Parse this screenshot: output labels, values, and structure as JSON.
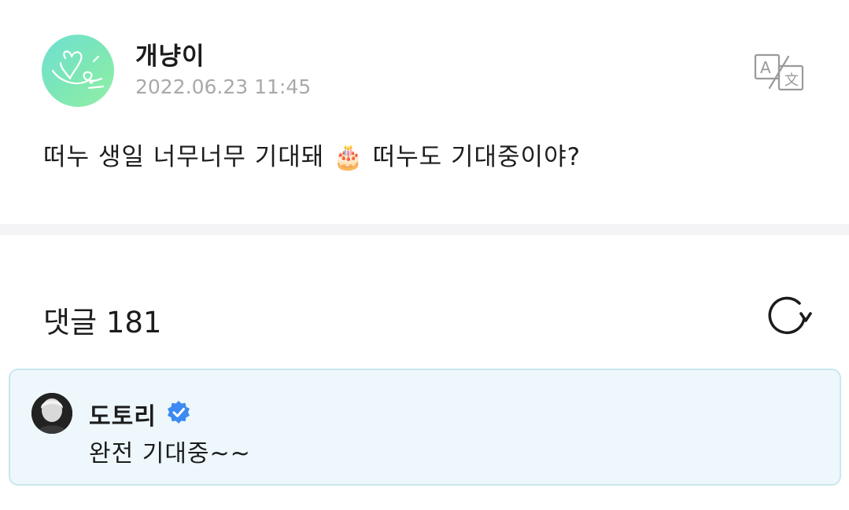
{
  "post": {
    "author": "개냥이",
    "date": "2022.06.23 11:45",
    "body": "떠누 생일 너무너무 기대돼 🎂 떠누도 기대중이야?",
    "avatar_icon": "heart-signature-avatar",
    "translate_icon": "translate-icon"
  },
  "comments": {
    "header": "댓글 181",
    "refresh_icon": "refresh-icon",
    "items": [
      {
        "author": "도토리",
        "verified": true,
        "text": "완전 기대중~~"
      }
    ]
  },
  "colors": {
    "avatar_gradient_start": "#6fe0d4",
    "avatar_gradient_end": "#93f0a6",
    "date_gray": "#a9a9a9",
    "comment_bg": "#eef8fc",
    "comment_border": "#c9e7ef",
    "verified_blue": "#3d8bf2"
  }
}
